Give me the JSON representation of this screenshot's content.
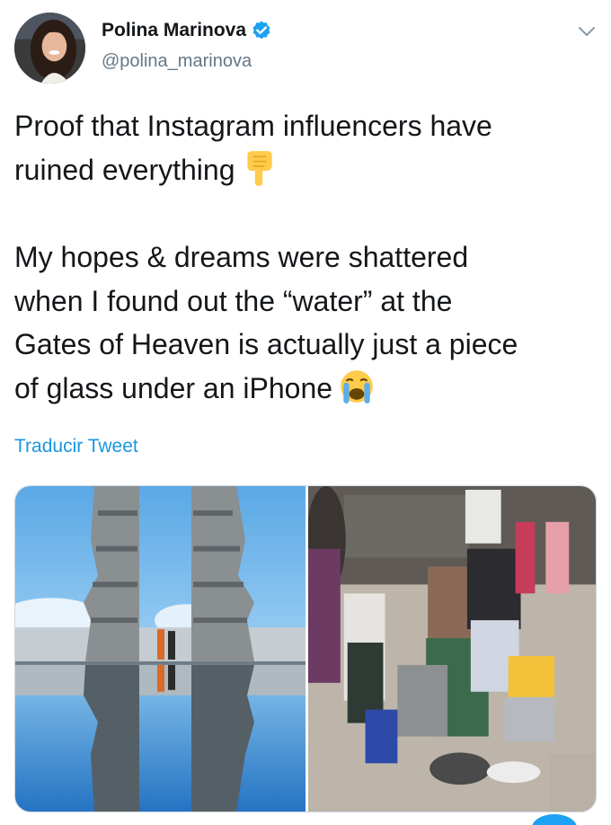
{
  "tweet": {
    "display_name": "Polina Marinova",
    "handle": "@polina_marinova",
    "verified": true,
    "text_paragraph_1_line_1": "Proof that Instagram influencers have",
    "text_paragraph_1_line_2": "ruined everything",
    "text_paragraph_1_emoji": "backhand-index-pointing-down-emoji",
    "text_paragraph_2_line_1": "My hopes & dreams were shattered",
    "text_paragraph_2_line_2": "when I found out the “water” at the",
    "text_paragraph_2_line_3": "Gates of Heaven is actually just a piece",
    "text_paragraph_2_line_4": "of glass under an iPhone",
    "text_paragraph_2_emoji": "loudly-crying-face-emoji",
    "translate_label": "Traducir Tweet"
  },
  "icons": {
    "avatar": "avatar",
    "verified": "verified-badge-icon",
    "menu": "chevron-down-icon"
  },
  "colors": {
    "primary_text": "#14171a",
    "secondary_text": "#657786",
    "link": "#1b95e0",
    "verified_blue": "#1da1f2",
    "border": "#ccd6dd"
  },
  "media": {
    "images": [
      "gates-of-heaven-reflection-photo",
      "tourists-with-phone-and-glass-photo"
    ]
  }
}
